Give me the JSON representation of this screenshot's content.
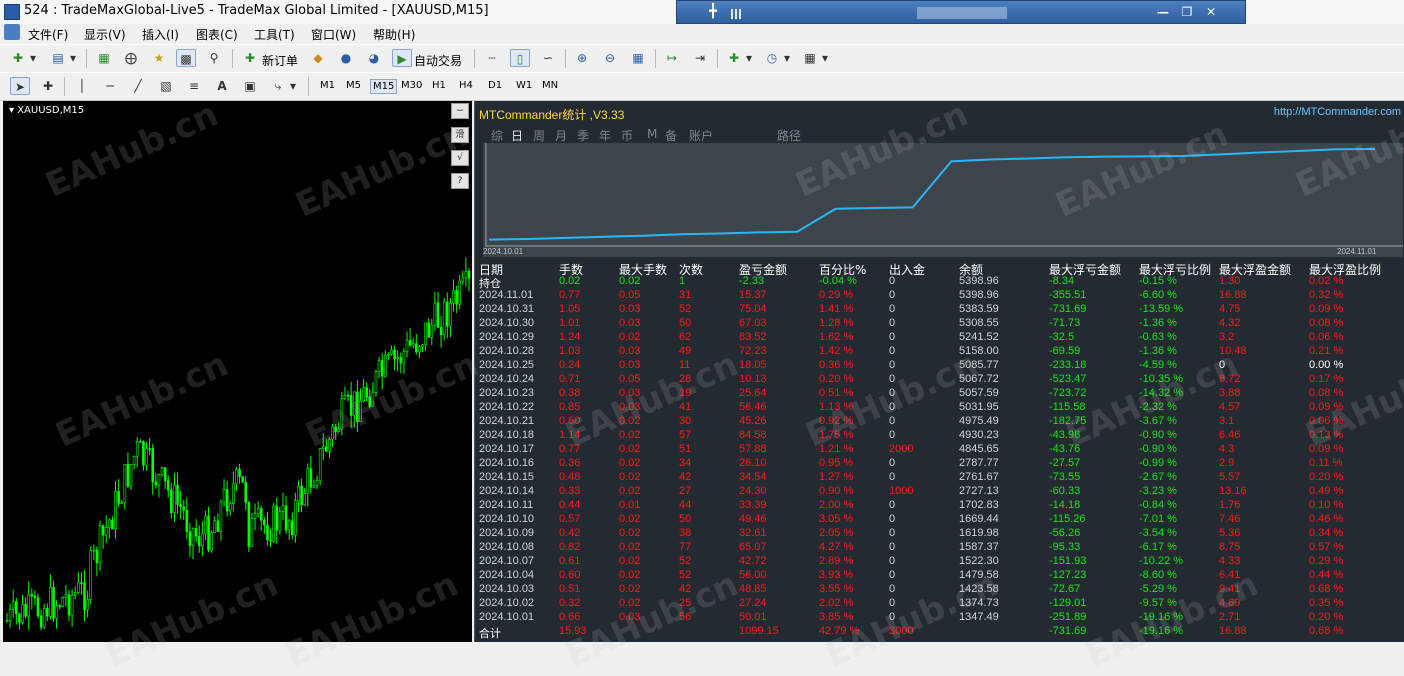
{
  "window": {
    "title": "524      : TradeMaxGlobal-Live5 - TradeMax Global Limited - [XAUUSD,M15]"
  },
  "menu": [
    "文件(F)",
    "显示(V)",
    "插入(I)",
    "图表(C)",
    "工具(T)",
    "窗口(W)",
    "帮助(H)"
  ],
  "toolbar": {
    "new_order": "新订单",
    "auto_trade": "自动交易"
  },
  "timeframes": [
    "M1",
    "M5",
    "M15",
    "M30",
    "H1",
    "H4",
    "D1",
    "W1",
    "MN"
  ],
  "selected_timeframe": "M15",
  "chart": {
    "symbol_label": "XAUUSD,M15",
    "candle_color": "#00ff00"
  },
  "side_buttons": [
    "−",
    "滑",
    "√",
    "?"
  ],
  "watermark": "EAHub.cn",
  "panel": {
    "title": "MTCommander统计 ,V3.33",
    "url": "http://MTCommander.com",
    "tabs": [
      "综",
      "日",
      "周",
      "月",
      "季",
      "年",
      "币",
      "M",
      "备",
      "账户",
      "路径"
    ],
    "active_tab": "日",
    "graph_start": "2024.10.01",
    "graph_end": "2024.11.01",
    "graph_color": "#29b6f6",
    "headers": [
      "日期",
      "手数",
      "最大手数",
      "次数",
      "盈亏金额",
      "百分比%",
      "出入金",
      "余额",
      "最大浮亏金额",
      "最大浮亏比例",
      "最大浮盈金额",
      "最大浮盈比例"
    ],
    "hold": [
      "持仓",
      "0.02",
      "0.02",
      "1",
      "-2.33",
      "-0.04 %",
      "0",
      "5398.96",
      "-8.34",
      "-0.15 %",
      "1.30",
      "0.02 %"
    ],
    "rows": [
      [
        "2024.11.01",
        "0.77",
        "0.05",
        "31",
        "15.37",
        "0.29 %",
        "0",
        "5398.96",
        "-355.51",
        "-6.60 %",
        "16.88",
        "0.32 %"
      ],
      [
        "2024.10.31",
        "1.05",
        "0.03",
        "52",
        "75.04",
        "1.41 %",
        "0",
        "5383.59",
        "-731.69",
        "-13.59 %",
        "4.75",
        "0.09 %"
      ],
      [
        "2024.10.30",
        "1.01",
        "0.03",
        "50",
        "67.03",
        "1.28 %",
        "0",
        "5308.55",
        "-71.73",
        "-1.36 %",
        "4.32",
        "0.08 %"
      ],
      [
        "2024.10.29",
        "1.24",
        "0.02",
        "62",
        "83.52",
        "1.62 %",
        "0",
        "5241.52",
        "-32.5",
        "-0.63 %",
        "3.2",
        "0.06 %"
      ],
      [
        "2024.10.28",
        "1.03",
        "0.03",
        "49",
        "72.23",
        "1.42 %",
        "0",
        "5158.00",
        "-69.59",
        "-1.36 %",
        "10.48",
        "0.21 %"
      ],
      [
        "2024.10.25",
        "0.24",
        "0.03",
        "11",
        "18.05",
        "0.36 %",
        "0",
        "5085.77",
        "-233.18",
        "-4.59 %",
        "0",
        "0.00 %"
      ],
      [
        "2024.10.24",
        "0.71",
        "0.05",
        "28",
        "10.13",
        "0.20 %",
        "0",
        "5067.72",
        "-523.47",
        "-10.35 %",
        "8.72",
        "0.17 %"
      ],
      [
        "2024.10.23",
        "0.38",
        "0.03",
        "19",
        "25.64",
        "0.51 %",
        "0",
        "5057.59",
        "-723.72",
        "-14.32 %",
        "3.88",
        "0.08 %"
      ],
      [
        "2024.10.22",
        "0.85",
        "0.03",
        "41",
        "56.46",
        "1.13 %",
        "0",
        "5031.95",
        "-115.58",
        "-2.32 %",
        "4.57",
        "0.09 %"
      ],
      [
        "2024.10.21",
        "0.60",
        "0.02",
        "30",
        "45.26",
        "0.92 %",
        "0",
        "4975.49",
        "-182.75",
        "-3.67 %",
        "3.1",
        "0.06 %"
      ],
      [
        "2024.10.18",
        "1.14",
        "0.02",
        "57",
        "84.58",
        "1.75 %",
        "0",
        "4930.23",
        "-43.98",
        "-0.90 %",
        "6.46",
        "0.13 %"
      ],
      [
        "2024.10.17",
        "0.77",
        "0.02",
        "51",
        "57.88",
        "1.21 %",
        "2000",
        "4845.65",
        "-43.76",
        "-0.90 %",
        "4.3",
        "0.09 %"
      ],
      [
        "2024.10.16",
        "0.36",
        "0.02",
        "34",
        "26.10",
        "0.95 %",
        "0",
        "2787.77",
        "-27.57",
        "-0.99 %",
        "2.9",
        "0.11 %"
      ],
      [
        "2024.10.15",
        "0.48",
        "0.02",
        "42",
        "34.54",
        "1.27 %",
        "0",
        "2761.67",
        "-73.55",
        "-2.67 %",
        "5.57",
        "0.20 %"
      ],
      [
        "2024.10.14",
        "0.33",
        "0.02",
        "27",
        "24.30",
        "0.90 %",
        "1000",
        "2727.13",
        "-60.33",
        "-3.23 %",
        "13.16",
        "0.49 %"
      ],
      [
        "2024.10.11",
        "0.44",
        "0.01",
        "44",
        "33.39",
        "2.00 %",
        "0",
        "1702.83",
        "-14.18",
        "-0.84 %",
        "1.76",
        "0.10 %"
      ],
      [
        "2024.10.10",
        "0.57",
        "0.02",
        "50",
        "49.46",
        "3.05 %",
        "0",
        "1669.44",
        "-115.26",
        "-7.01 %",
        "7.46",
        "0.46 %"
      ],
      [
        "2024.10.09",
        "0.42",
        "0.02",
        "38",
        "32.61",
        "2.05 %",
        "0",
        "1619.98",
        "-56.26",
        "-3.54 %",
        "5.36",
        "0.34 %"
      ],
      [
        "2024.10.08",
        "0.82",
        "0.02",
        "77",
        "65.07",
        "4.27 %",
        "0",
        "1587.37",
        "-95.33",
        "-6.17 %",
        "8.75",
        "0.57 %"
      ],
      [
        "2024.10.07",
        "0.61",
        "0.02",
        "52",
        "42.72",
        "2.89 %",
        "0",
        "1522.30",
        "-151.93",
        "-10.22 %",
        "4.33",
        "0.29 %"
      ],
      [
        "2024.10.04",
        "0.60",
        "0.02",
        "52",
        "56.00",
        "3.93 %",
        "0",
        "1479.58",
        "-127.23",
        "-8.60 %",
        "6.41",
        "0.44 %"
      ],
      [
        "2024.10.03",
        "0.51",
        "0.02",
        "42",
        "48.85",
        "3.55 %",
        "0",
        "1423.58",
        "-72.67",
        "-5.29 %",
        "9.41",
        "0.68 %"
      ],
      [
        "2024.10.02",
        "0.32",
        "0.02",
        "25",
        "27.24",
        "2.02 %",
        "0",
        "1374.73",
        "-129.01",
        "-9.57 %",
        "4.69",
        "0.35 %"
      ],
      [
        "2024.10.01",
        "0.66",
        "0.03",
        "56",
        "50.01",
        "3.85 %",
        "0",
        "1347.49",
        "-251.89",
        "-19.16 %",
        "2.71",
        "0.20 %"
      ]
    ],
    "total": [
      "合计",
      "15.93",
      "",
      "",
      "1099.15",
      "42.79 %",
      "3000",
      "",
      "-731.69",
      "-19.16 %",
      "16.88",
      "0.68 %"
    ]
  }
}
